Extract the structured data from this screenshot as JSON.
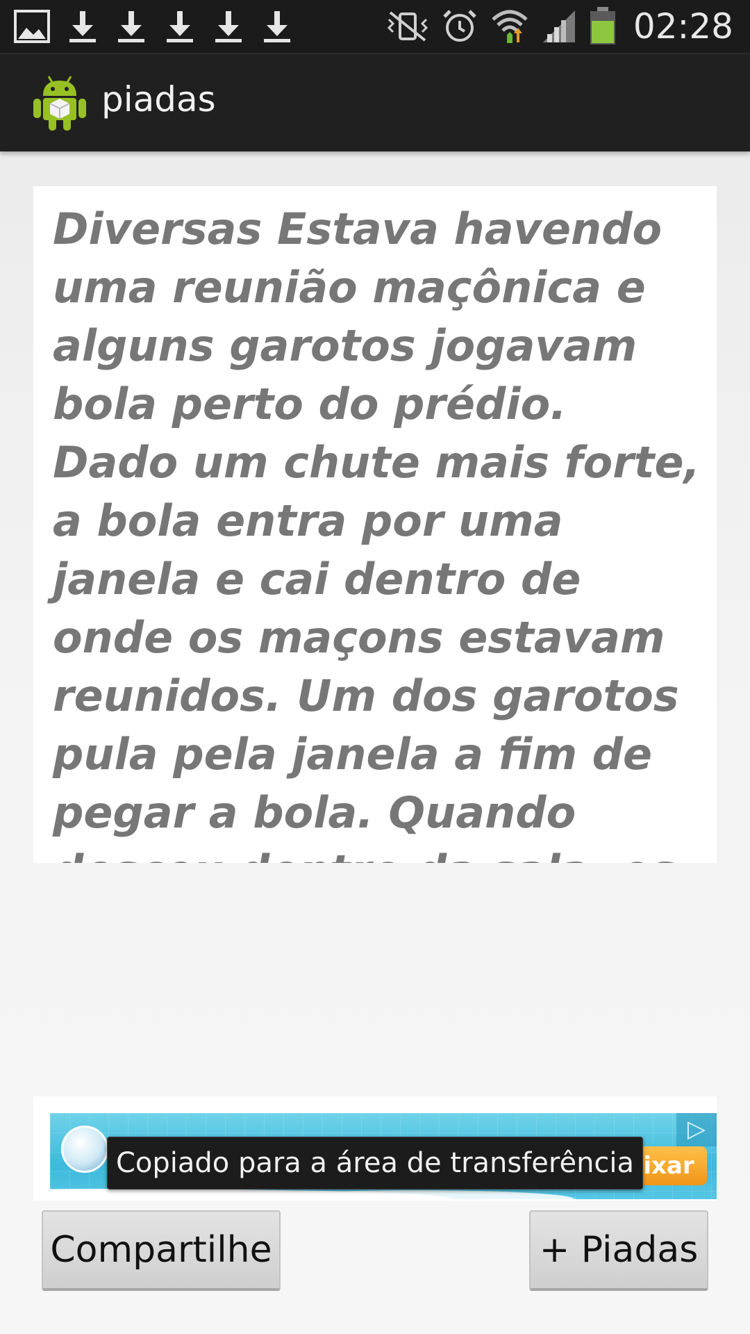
{
  "status_bar": {
    "left_icons": [
      "image-notification-icon",
      "download-icon",
      "download-icon",
      "download-icon",
      "download-icon",
      "download-icon"
    ],
    "right_icons": [
      "vibrate-icon",
      "alarm-icon",
      "wifi-icon",
      "signal-icon",
      "battery-icon"
    ],
    "time": "02:28"
  },
  "action_bar": {
    "icon": "android-app-icon",
    "title": "piadas"
  },
  "joke": {
    "text": "Diversas Estava havendo uma reunião maçônica e alguns garotos jogavam bola perto do prédio. Dado um chute mais forte, a bola entra por uma janela e cai dentro de onde os maçons estavam reunidos. Um dos garotos pula pela janela a fim de pegar a bola. Quando desceu dentro da sala, os maçons imediatamente"
  },
  "ad": {
    "button_label": "ixar",
    "choices_icon": "ad-choices-icon"
  },
  "toast": {
    "message": "Copiado para a área de transferência"
  },
  "buttons": {
    "share_label": "Compartilhe",
    "more_label": "+ Piadas"
  },
  "colors": {
    "status_bar_bg": "#1b1b1b",
    "action_bar_bg": "#202020",
    "joke_text": "#777777",
    "battery_green": "#8dc63f",
    "android_green": "#97c024"
  }
}
